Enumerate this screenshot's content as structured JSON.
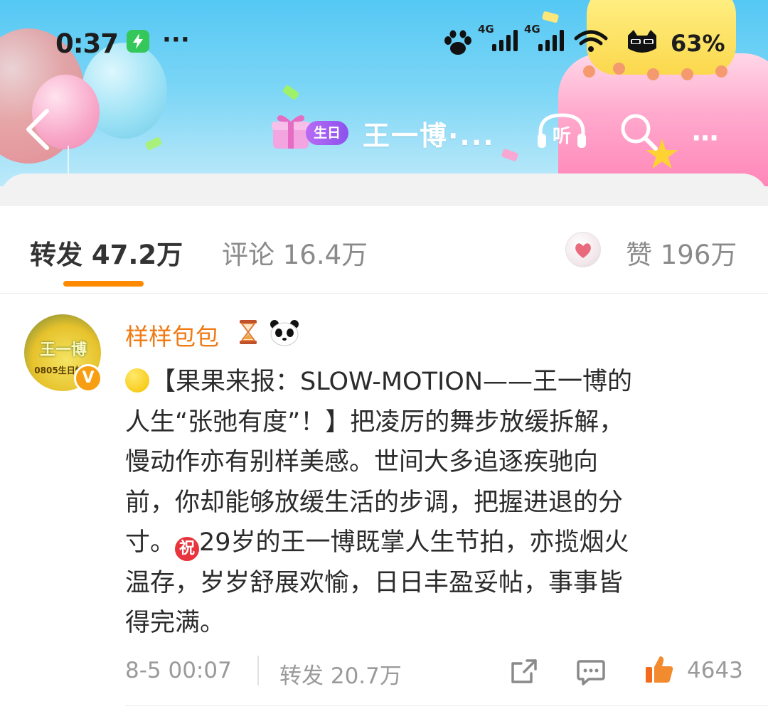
{
  "status_bar": {
    "time": "0:37",
    "more": "···",
    "net1": "4G",
    "net2": "4G",
    "battery": "63%"
  },
  "header": {
    "badge": "生日",
    "title": "王一博·...",
    "more": "···"
  },
  "icons": {
    "back": "back-chevron-icon",
    "gift": "gift-icon",
    "listen": "headphones-listen-icon",
    "search": "search-icon",
    "share": "share-icon",
    "comment": "comment-icon",
    "like": "thumbs-up-icon"
  },
  "tabs": {
    "repost": "转发 47.2万",
    "comment": "评论 16.4万",
    "like": "赞 196万"
  },
  "colors": {
    "accent": "#ff8a00",
    "username": "#f07a14",
    "header_sky": "#55c8f4"
  },
  "post": {
    "avatar_text": "王一博",
    "avatar_sub": "0805生日快乐",
    "verified": "V",
    "username": "样样包包",
    "lines": [
      "【果果来报：SLOW-MOTION——王一博的",
      "人生“张弛有度”！】把凌厉的舞步放缓拆解，",
      "慢动作亦有别样美感。世间大多追逐疾驰向",
      "前，你却能够放缓生活的步调，把握进退的分",
      "29岁的王一博既掌人生节拍，亦揽烟火",
      "温存，岁岁舒展欢愉，日日丰盈妥帖，事事皆",
      "得完满。"
    ],
    "line5_prefix": "寸。",
    "congrats_char": "祝",
    "time": "8-5 00:07",
    "reposts": "转发 20.7万",
    "likes": "4643"
  }
}
